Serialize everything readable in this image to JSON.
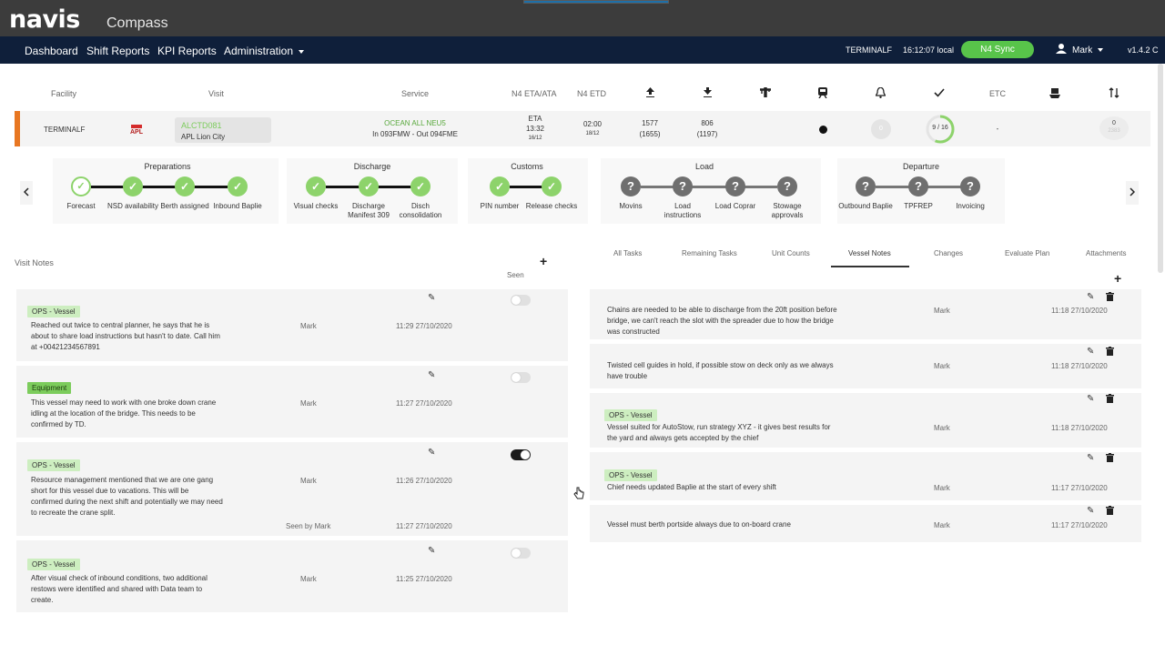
{
  "brand": {
    "logo": "navis",
    "product": "Compass"
  },
  "nav": {
    "items": [
      "Dashboard",
      "Shift Reports",
      "KPI Reports",
      "Administration"
    ],
    "terminal": "TERMINALF",
    "time": "16:12:07 local",
    "sync": "N4 Sync",
    "user": "Mark",
    "version": "v1.4.2 C"
  },
  "visit_table": {
    "headers": {
      "facility": "Facility",
      "visit": "Visit",
      "service": "Service",
      "n4_eta_ata": "N4 ETA/ATA",
      "n4_etd": "N4 ETD",
      "etc": "ETC"
    },
    "row": {
      "facility": "TERMINALF",
      "operator": "APL",
      "visit_id": "ALCTD081",
      "vessel_name": "APL Lion City",
      "service_name": "OCEAN ALL NEU5",
      "service_voyage": "In 093FMW - Out 094FME",
      "eta_label": "ETA",
      "eta_time": "13:32",
      "eta_date": "16/12",
      "etd_time": "02:00",
      "etd_date": "18/12",
      "load_count": "1577",
      "load_sub": "(1655)",
      "discharge_count": "806",
      "discharge_sub": "(1197)",
      "alerts_value": "0",
      "checks_progress": "9 / 16",
      "checks_fraction": 0.5625,
      "etc_value": "-",
      "last_count": "0",
      "last_sub": "2383"
    }
  },
  "milestones": {
    "groups": [
      {
        "title": "Preparations",
        "steps": [
          "Forecast",
          "NSD availability",
          "Berth assigned",
          "Inbound Baplie"
        ]
      },
      {
        "title": "Discharge",
        "steps": [
          "Visual checks",
          "Discharge Manifest 309",
          "Disch consolidation"
        ]
      },
      {
        "title": "Customs",
        "steps": [
          "PIN number",
          "Release checks"
        ]
      },
      {
        "title": "Load",
        "steps": [
          "Movins",
          "Load instructions",
          "Load Coprar",
          "Stowage approvals"
        ]
      },
      {
        "title": "Departure",
        "steps": [
          "Outbound Baplie",
          "TPFREP",
          "Invoicing"
        ]
      }
    ],
    "done_glyph": "✓",
    "todo_glyph": "?"
  },
  "visit_notes": {
    "title": "Visit Notes",
    "seen_header": "Seen",
    "notes": [
      {
        "tag": "OPS - Vessel",
        "text": [
          "Reached out twice to central planner, he says that he is",
          "about to share load instructions but hasn't to date. Call him",
          "at +00421234567891"
        ],
        "author": "Mark",
        "time": "11:29 27/10/2020",
        "seen": false
      },
      {
        "tag": "Equipment",
        "text": [
          "This vessel may need to work with one broke down crane",
          "idling at the location of the bridge. This needs to be",
          "confirmed by TD."
        ],
        "author": "Mark",
        "time": "11:27 27/10/2020",
        "seen": false
      },
      {
        "tag": "OPS - Vessel",
        "text": [
          "Resource management mentioned that we are one gang",
          "short for this vessel due to vacations. This will be",
          "confirmed during the next shift and potentially we may need",
          "to recreate the crane split."
        ],
        "author": "Mark",
        "time": "11:26 27/10/2020",
        "seen": true,
        "seen_by": "Seen by Mark",
        "seen_time": "11:27 27/10/2020"
      },
      {
        "tag": "OPS - Vessel",
        "text": [
          "After visual check of inbound conditions, two additional",
          "restows were identified and shared with Data team to",
          "create."
        ],
        "author": "Mark",
        "time": "11:25 27/10/2020",
        "seen": false
      }
    ]
  },
  "tabs": [
    "All Tasks",
    "Remaining Tasks",
    "Unit Counts",
    "Vessel Notes",
    "Changes",
    "Evaluate Plan",
    "Attachments"
  ],
  "active_tab": "Vessel Notes",
  "vessel_notes": [
    {
      "tag": "",
      "text": [
        "Chains are needed to be able to discharge from the 20ft position before",
        "bridge, we can't reach the slot with the spreader due to how the bridge",
        "was constructed"
      ],
      "author": "Mark",
      "time": "11:18 27/10/2020"
    },
    {
      "tag": "",
      "text": [
        "Twisted cell guides in hold, if possible stow on deck only as we always",
        "have trouble"
      ],
      "author": "Mark",
      "time": "11:18 27/10/2020"
    },
    {
      "tag": "OPS - Vessel",
      "text": [
        "Vessel suited for AutoStow, run strategy XYZ - it gives best results for",
        "the yard and always gets accepted by the chief"
      ],
      "author": "Mark",
      "time": "11:18 27/10/2020"
    },
    {
      "tag": "OPS - Vessel",
      "text": [
        "Chief needs updated Baplie at the start of every shift"
      ],
      "author": "Mark",
      "time": "11:17 27/10/2020"
    },
    {
      "tag": "",
      "text": [
        "Vessel must berth portside always due to on-board crane"
      ],
      "author": "Mark",
      "time": "11:17 27/10/2020"
    }
  ],
  "colors": {
    "accent_orange": "#e87722",
    "done_green": "#8dd36b",
    "todo_grey": "#6f6f6f",
    "nav_bg": "#0f1f3a",
    "sync_green": "#58c44a"
  }
}
